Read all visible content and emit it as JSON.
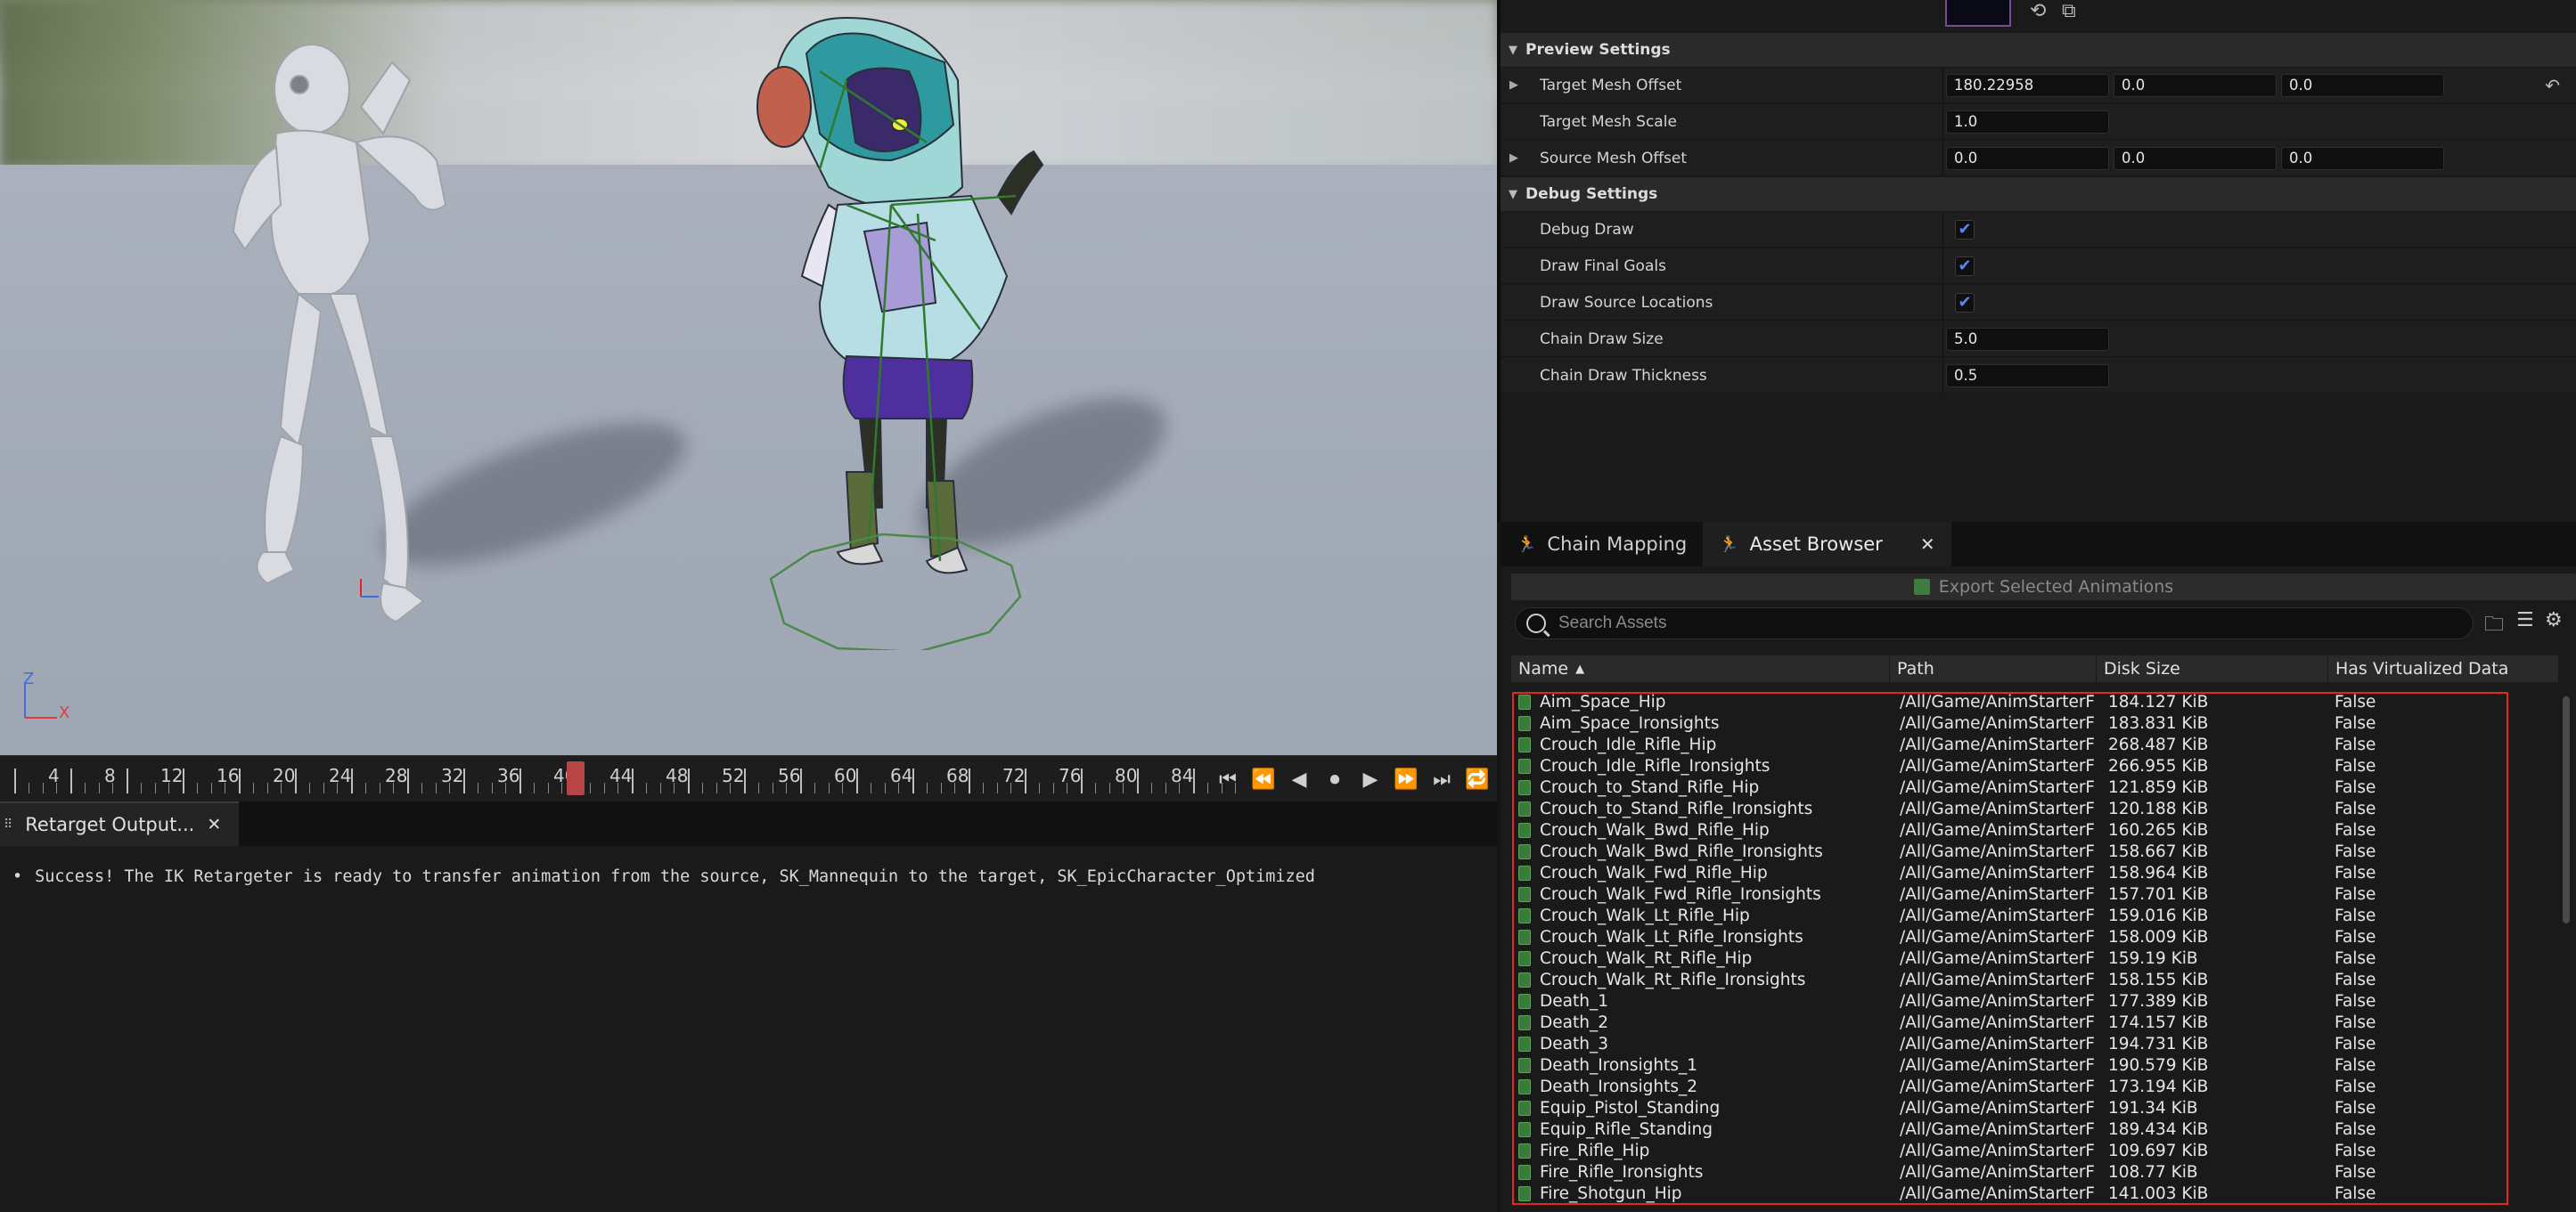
{
  "viewport": {
    "axis_x": "X",
    "axis_z": "Z"
  },
  "timeline": {
    "ticks": [
      "4",
      "8",
      "12",
      "16",
      "20",
      "24",
      "28",
      "32",
      "36",
      "40",
      "44",
      "48",
      "52",
      "56",
      "60",
      "64",
      "68",
      "72",
      "76",
      "80",
      "84"
    ],
    "current_frame": 41
  },
  "output_log": {
    "tab_label": "Retarget Output...",
    "message": "Success! The IK Retargeter is ready to transfer animation from the source, SK_Mannequin to the target, SK_EpicCharacter_Optimized"
  },
  "details": {
    "preview_settings": {
      "title": "Preview Settings",
      "target_mesh_offset": {
        "label": "Target Mesh Offset",
        "x": "180.22958",
        "y": "0.0",
        "z": "0.0"
      },
      "target_mesh_scale": {
        "label": "Target Mesh Scale",
        "value": "1.0"
      },
      "source_mesh_offset": {
        "label": "Source Mesh Offset",
        "x": "0.0",
        "y": "0.0",
        "z": "0.0"
      }
    },
    "debug_settings": {
      "title": "Debug Settings",
      "debug_draw": {
        "label": "Debug Draw",
        "checked": true
      },
      "draw_final_goals": {
        "label": "Draw Final Goals",
        "checked": true
      },
      "draw_source_locations": {
        "label": "Draw Source Locations",
        "checked": true
      },
      "chain_draw_size": {
        "label": "Chain Draw Size",
        "value": "5.0"
      },
      "chain_draw_thickness": {
        "label": "Chain Draw Thickness",
        "value": "0.5"
      }
    }
  },
  "panel_tabs": {
    "chain_mapping": "Chain Mapping",
    "asset_browser": "Asset Browser"
  },
  "asset_browser": {
    "export_label": "Export Selected Animations",
    "search_placeholder": "Search Assets",
    "columns": [
      "Name",
      "Path",
      "Disk Size",
      "Has Virtualized Data"
    ],
    "rows": [
      [
        "Aim_Space_Hip",
        "/All/Game/AnimStarterF",
        "184.127 KiB",
        "False"
      ],
      [
        "Aim_Space_Ironsights",
        "/All/Game/AnimStarterF",
        "183.831 KiB",
        "False"
      ],
      [
        "Crouch_Idle_Rifle_Hip",
        "/All/Game/AnimStarterF",
        "268.487 KiB",
        "False"
      ],
      [
        "Crouch_Idle_Rifle_Ironsights",
        "/All/Game/AnimStarterF",
        "266.955 KiB",
        "False"
      ],
      [
        "Crouch_to_Stand_Rifle_Hip",
        "/All/Game/AnimStarterF",
        "121.859 KiB",
        "False"
      ],
      [
        "Crouch_to_Stand_Rifle_Ironsights",
        "/All/Game/AnimStarterF",
        "120.188 KiB",
        "False"
      ],
      [
        "Crouch_Walk_Bwd_Rifle_Hip",
        "/All/Game/AnimStarterF",
        "160.265 KiB",
        "False"
      ],
      [
        "Crouch_Walk_Bwd_Rifle_Ironsights",
        "/All/Game/AnimStarterF",
        "158.667 KiB",
        "False"
      ],
      [
        "Crouch_Walk_Fwd_Rifle_Hip",
        "/All/Game/AnimStarterF",
        "158.964 KiB",
        "False"
      ],
      [
        "Crouch_Walk_Fwd_Rifle_Ironsights",
        "/All/Game/AnimStarterF",
        "157.701 KiB",
        "False"
      ],
      [
        "Crouch_Walk_Lt_Rifle_Hip",
        "/All/Game/AnimStarterF",
        "159.016 KiB",
        "False"
      ],
      [
        "Crouch_Walk_Lt_Rifle_Ironsights",
        "/All/Game/AnimStarterF",
        "158.009 KiB",
        "False"
      ],
      [
        "Crouch_Walk_Rt_Rifle_Hip",
        "/All/Game/AnimStarterF",
        "159.19 KiB",
        "False"
      ],
      [
        "Crouch_Walk_Rt_Rifle_Ironsights",
        "/All/Game/AnimStarterF",
        "158.155 KiB",
        "False"
      ],
      [
        "Death_1",
        "/All/Game/AnimStarterF",
        "177.389 KiB",
        "False"
      ],
      [
        "Death_2",
        "/All/Game/AnimStarterF",
        "174.157 KiB",
        "False"
      ],
      [
        "Death_3",
        "/All/Game/AnimStarterF",
        "194.731 KiB",
        "False"
      ],
      [
        "Death_Ironsights_1",
        "/All/Game/AnimStarterF",
        "190.579 KiB",
        "False"
      ],
      [
        "Death_Ironsights_2",
        "/All/Game/AnimStarterF",
        "173.194 KiB",
        "False"
      ],
      [
        "Equip_Pistol_Standing",
        "/All/Game/AnimStarterF",
        "191.34 KiB",
        "False"
      ],
      [
        "Equip_Rifle_Standing",
        "/All/Game/AnimStarterF",
        "189.434 KiB",
        "False"
      ],
      [
        "Fire_Rifle_Hip",
        "/All/Game/AnimStarterF",
        "109.697 KiB",
        "False"
      ],
      [
        "Fire_Rifle_Ironsights",
        "/All/Game/AnimStarterF",
        "108.77 KiB",
        "False"
      ],
      [
        "Fire_Shotgun_Hip",
        "/All/Game/AnimStarterF",
        "141.003 KiB",
        "False"
      ]
    ]
  },
  "colors": {
    "accent_check": "#4f8bf0",
    "selection": "#e32525",
    "playhead": "#b84545"
  }
}
